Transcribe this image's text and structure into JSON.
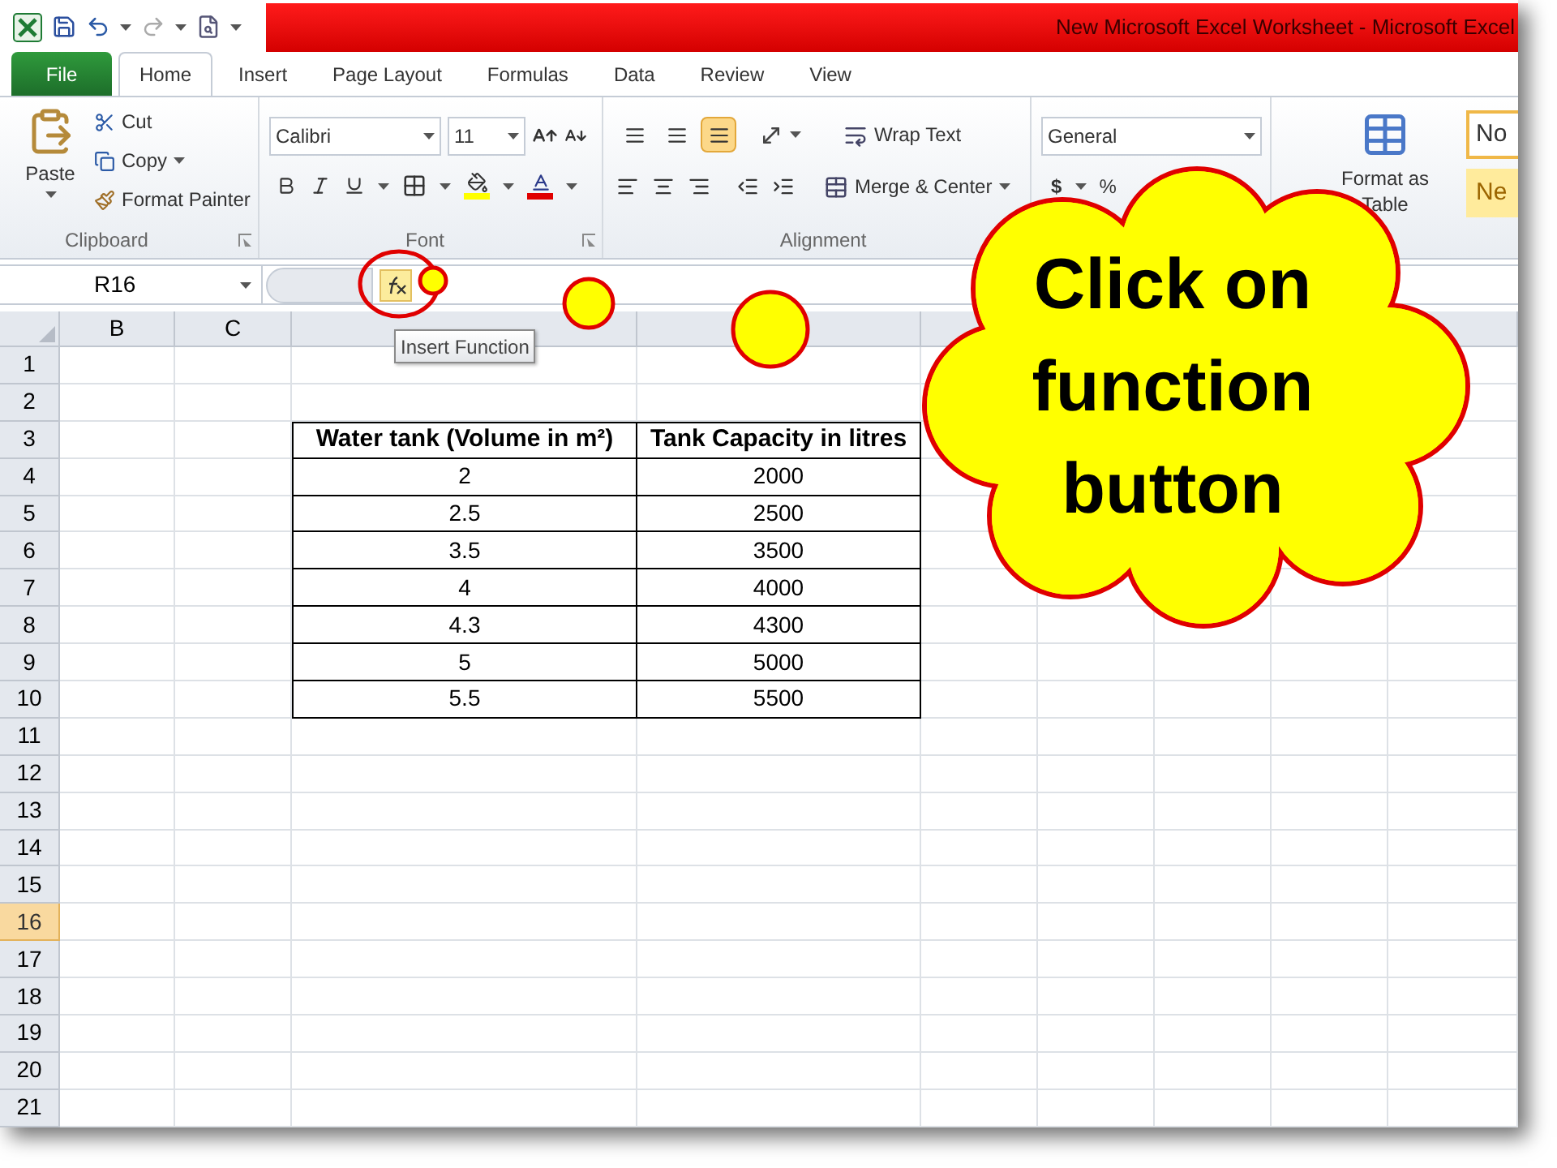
{
  "window": {
    "title": "New Microsoft Excel Worksheet - Microsoft Excel"
  },
  "tabs": [
    {
      "label": "File",
      "kind": "file",
      "selected": false
    },
    {
      "label": "Home",
      "kind": "tab",
      "selected": true
    },
    {
      "label": "Insert",
      "kind": "tab",
      "selected": false
    },
    {
      "label": "Page Layout",
      "kind": "tab",
      "selected": false
    },
    {
      "label": "Formulas",
      "kind": "tab",
      "selected": false
    },
    {
      "label": "Data",
      "kind": "tab",
      "selected": false
    },
    {
      "label": "Review",
      "kind": "tab",
      "selected": false
    },
    {
      "label": "View",
      "kind": "tab",
      "selected": false
    }
  ],
  "ribbon": {
    "clipboard": {
      "label": "Clipboard",
      "paste": "Paste",
      "cut": "Cut",
      "copy": "Copy",
      "format_painter": "Format Painter"
    },
    "font": {
      "label": "Font",
      "font_name": "Calibri",
      "font_size": "11"
    },
    "alignment": {
      "label": "Alignment",
      "vertical": [
        {
          "selected": false
        },
        {
          "selected": false
        },
        {
          "selected": true
        }
      ],
      "wrap_text": "Wrap Text",
      "merge_center": "Merge & Center"
    },
    "number": {
      "format": "General",
      "currency": "$",
      "percent": "%"
    },
    "styles": {
      "format_as_table": "Format as Table",
      "style_1": "No",
      "style_2": "Ne"
    }
  },
  "formula_bar": {
    "name_box": "R16"
  },
  "tooltip": "Insert Function",
  "columns": [
    "B",
    "C"
  ],
  "rows": [
    {
      "label": "1",
      "selected": false
    },
    {
      "label": "2",
      "selected": false
    },
    {
      "label": "3",
      "selected": false
    },
    {
      "label": "4",
      "selected": false
    },
    {
      "label": "5",
      "selected": false
    },
    {
      "label": "6",
      "selected": false
    },
    {
      "label": "7",
      "selected": false
    },
    {
      "label": "8",
      "selected": false
    },
    {
      "label": "9",
      "selected": false
    },
    {
      "label": "10",
      "selected": false
    },
    {
      "label": "11",
      "selected": false
    },
    {
      "label": "12",
      "selected": false
    },
    {
      "label": "13",
      "selected": false
    },
    {
      "label": "14",
      "selected": false
    },
    {
      "label": "15",
      "selected": false
    },
    {
      "label": "16",
      "selected": true
    },
    {
      "label": "17",
      "selected": false
    },
    {
      "label": "18",
      "selected": false
    },
    {
      "label": "19",
      "selected": false
    },
    {
      "label": "20",
      "selected": false
    },
    {
      "label": "21",
      "selected": false
    }
  ],
  "table": {
    "header": [
      "Water tank (Volume in m²)",
      "Tank Capacity in litres"
    ],
    "rows": [
      [
        "2",
        "2000"
      ],
      [
        "2.5",
        "2500"
      ],
      [
        "3.5",
        "3500"
      ],
      [
        "4",
        "4000"
      ],
      [
        "4.3",
        "4300"
      ],
      [
        "5",
        "5000"
      ],
      [
        "5.5",
        "5500"
      ]
    ]
  },
  "callout": {
    "text": "Click on function button"
  }
}
